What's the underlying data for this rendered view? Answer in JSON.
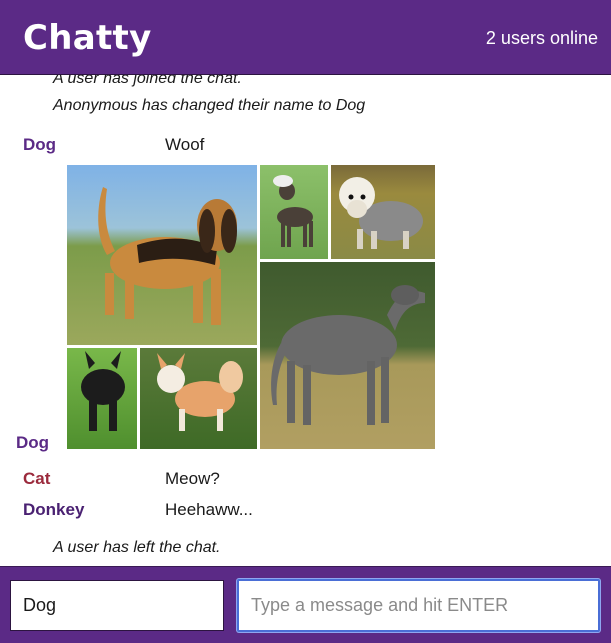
{
  "header": {
    "title": "Chatty",
    "online_status": "2 users online"
  },
  "messages": {
    "system_joined": "A user has joined the chat.",
    "system_renamed": "Anonymous has changed their name to Dog",
    "system_left": "A user has left the chat.",
    "items": [
      {
        "nick": "Dog",
        "text": "Woof"
      },
      {
        "nick": "Dog",
        "image": "dog-breeds-collage-image"
      },
      {
        "nick": "Cat",
        "text": "Meow?"
      },
      {
        "nick": "Donkey",
        "text": "Heehaww..."
      }
    ]
  },
  "colors": {
    "accent": "#5b2a86",
    "dog_nick": "#5b2a86",
    "cat_nick": "#9b2a3c",
    "donkey_nick": "#4a2172",
    "focus_border": "#4a6ed6"
  },
  "footer": {
    "name_value": "Dog",
    "message_placeholder": "Type a message and hit ENTER",
    "message_value": ""
  }
}
